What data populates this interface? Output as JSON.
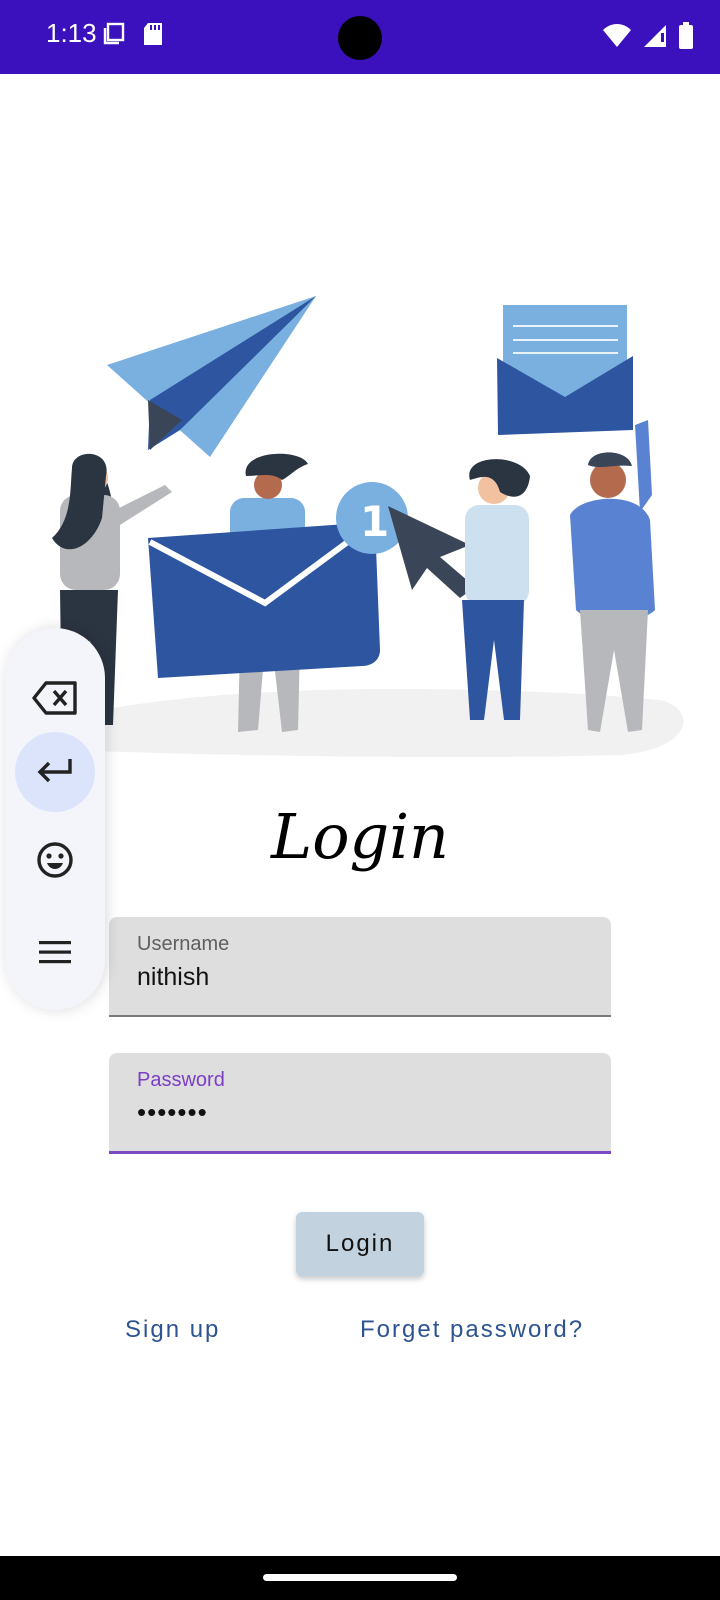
{
  "status_bar": {
    "time": "1:13",
    "icons": [
      "screenshot-icon",
      "sd-card-icon",
      "wifi-icon",
      "signal-icon",
      "battery-icon"
    ],
    "background": "#3b11bd"
  },
  "illustration": {
    "badge_number": "1",
    "description_icon": "people-mail-illustration"
  },
  "login": {
    "title": "Login",
    "username_label": "Username",
    "username_value": "nithish",
    "password_label": "Password",
    "password_value": "•••••••",
    "login_button": "Login",
    "signup_link": "Sign up",
    "forget_link": "Forget password?"
  },
  "toolbar": {
    "items": [
      "backspace-icon",
      "enter-icon",
      "emoji-icon",
      "menu-icon"
    ]
  },
  "colors": {
    "accent": "#7b4bc6",
    "link": "#2d5492",
    "button": "#c2d3df"
  }
}
